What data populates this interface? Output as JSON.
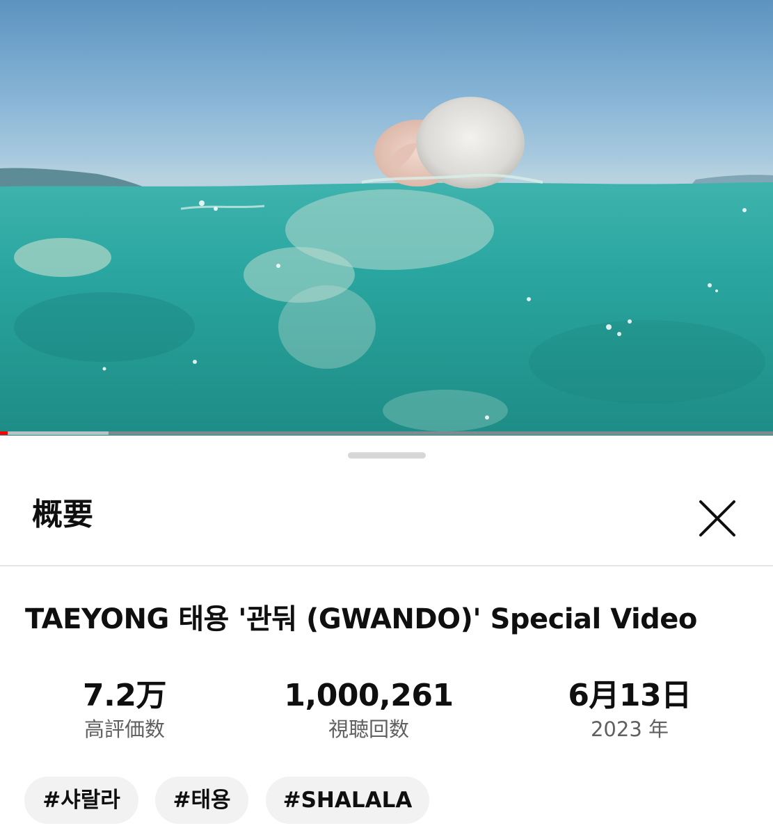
{
  "video": {
    "progress_played_fraction": 0.01,
    "progress_buffered_fraction": 0.14
  },
  "sheet": {
    "title": "概要",
    "video_title": "TAEYONG 태용 '관둬 (GWANDO)' Special Video",
    "stats": {
      "likes_value": "7.2万",
      "likes_label": "高評価数",
      "views_value": "1,000,261",
      "views_label": "視聴回数",
      "date_value": "6月13日",
      "date_label": "2023 年"
    },
    "tags": [
      "#샤랄라",
      "#태용",
      "#SHALALA"
    ]
  },
  "icons": {
    "close": "close-icon"
  },
  "colors": {
    "progress": "#ff0000",
    "tag_bg": "#f2f2f2",
    "label": "#606060"
  }
}
